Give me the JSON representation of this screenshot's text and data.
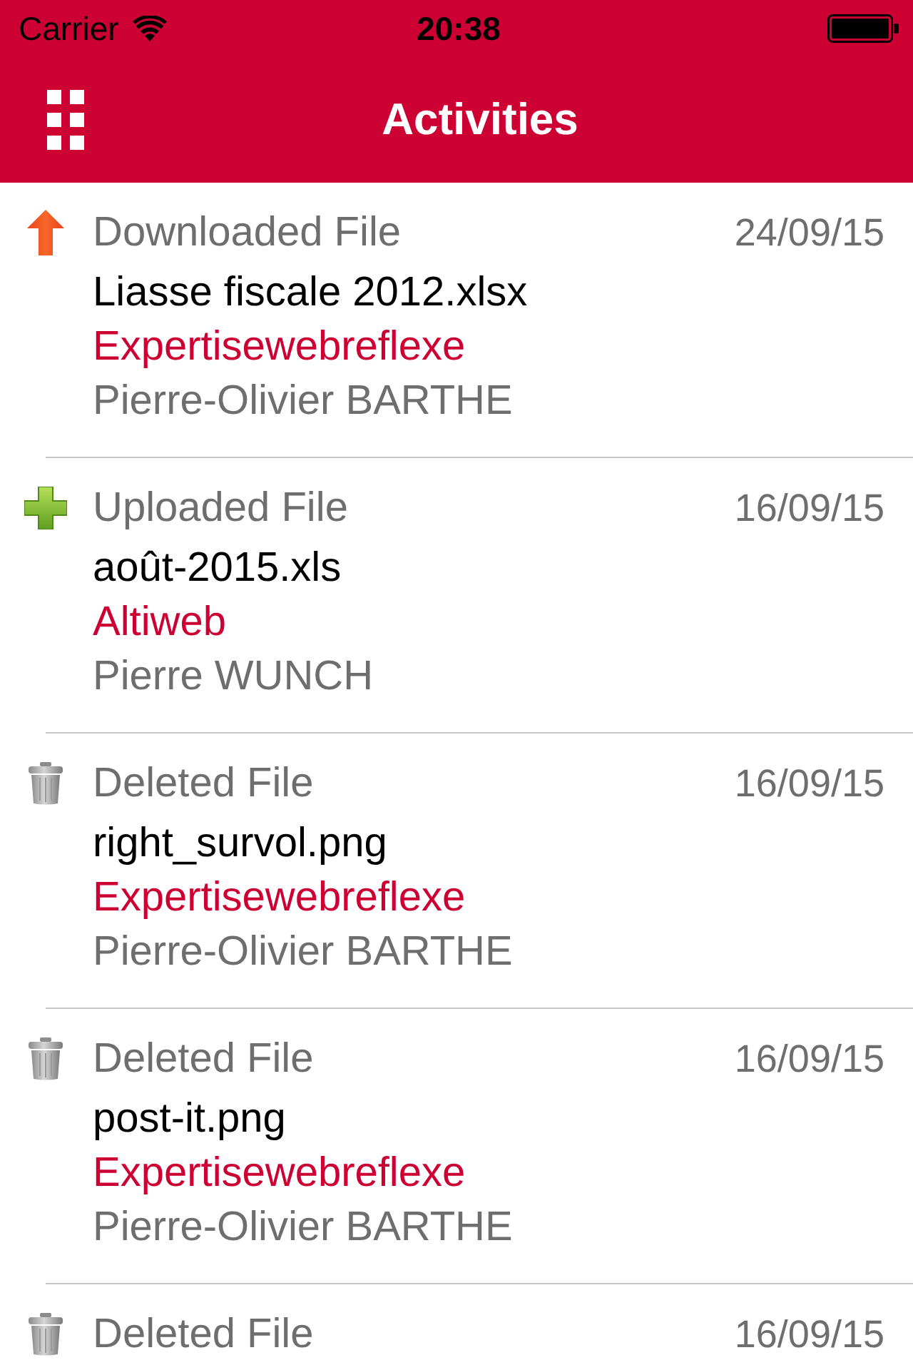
{
  "status_bar": {
    "carrier": "Carrier",
    "time": "20:38"
  },
  "nav_bar": {
    "title": "Activities"
  },
  "activities": [
    {
      "kind": "download",
      "action": "Downloaded File",
      "date": "24/09/15",
      "file": "Liasse fiscale 2012.xlsx",
      "workspace": "Expertisewebreflexe",
      "user": "Pierre-Olivier BARTHE"
    },
    {
      "kind": "upload",
      "action": "Uploaded File",
      "date": "16/09/15",
      "file": "août-2015.xls",
      "workspace": "Altiweb",
      "user": "Pierre WUNCH"
    },
    {
      "kind": "delete",
      "action": "Deleted File",
      "date": "16/09/15",
      "file": "right_survol.png",
      "workspace": "Expertisewebreflexe",
      "user": "Pierre-Olivier BARTHE"
    },
    {
      "kind": "delete",
      "action": "Deleted File",
      "date": "16/09/15",
      "file": "post-it.png",
      "workspace": "Expertisewebreflexe",
      "user": "Pierre-Olivier BARTHE"
    },
    {
      "kind": "delete",
      "action": "Deleted File",
      "date": "16/09/15"
    }
  ]
}
